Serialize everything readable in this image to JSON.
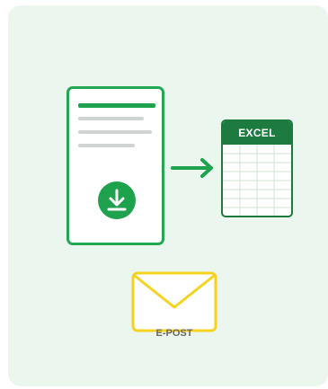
{
  "illustration": {
    "excel_label": "EXCEL",
    "mail_label": "E-POST"
  },
  "icons": {
    "document": "document-icon",
    "download": "download-icon",
    "arrow": "arrow-right-icon",
    "spreadsheet": "spreadsheet-icon",
    "mail": "envelope-icon"
  },
  "colors": {
    "background": "#eaf6ee",
    "green": "#22a852",
    "dark_green": "#1e7b3f",
    "yellow": "#f5d21f",
    "gray": "#cfd3d1"
  }
}
